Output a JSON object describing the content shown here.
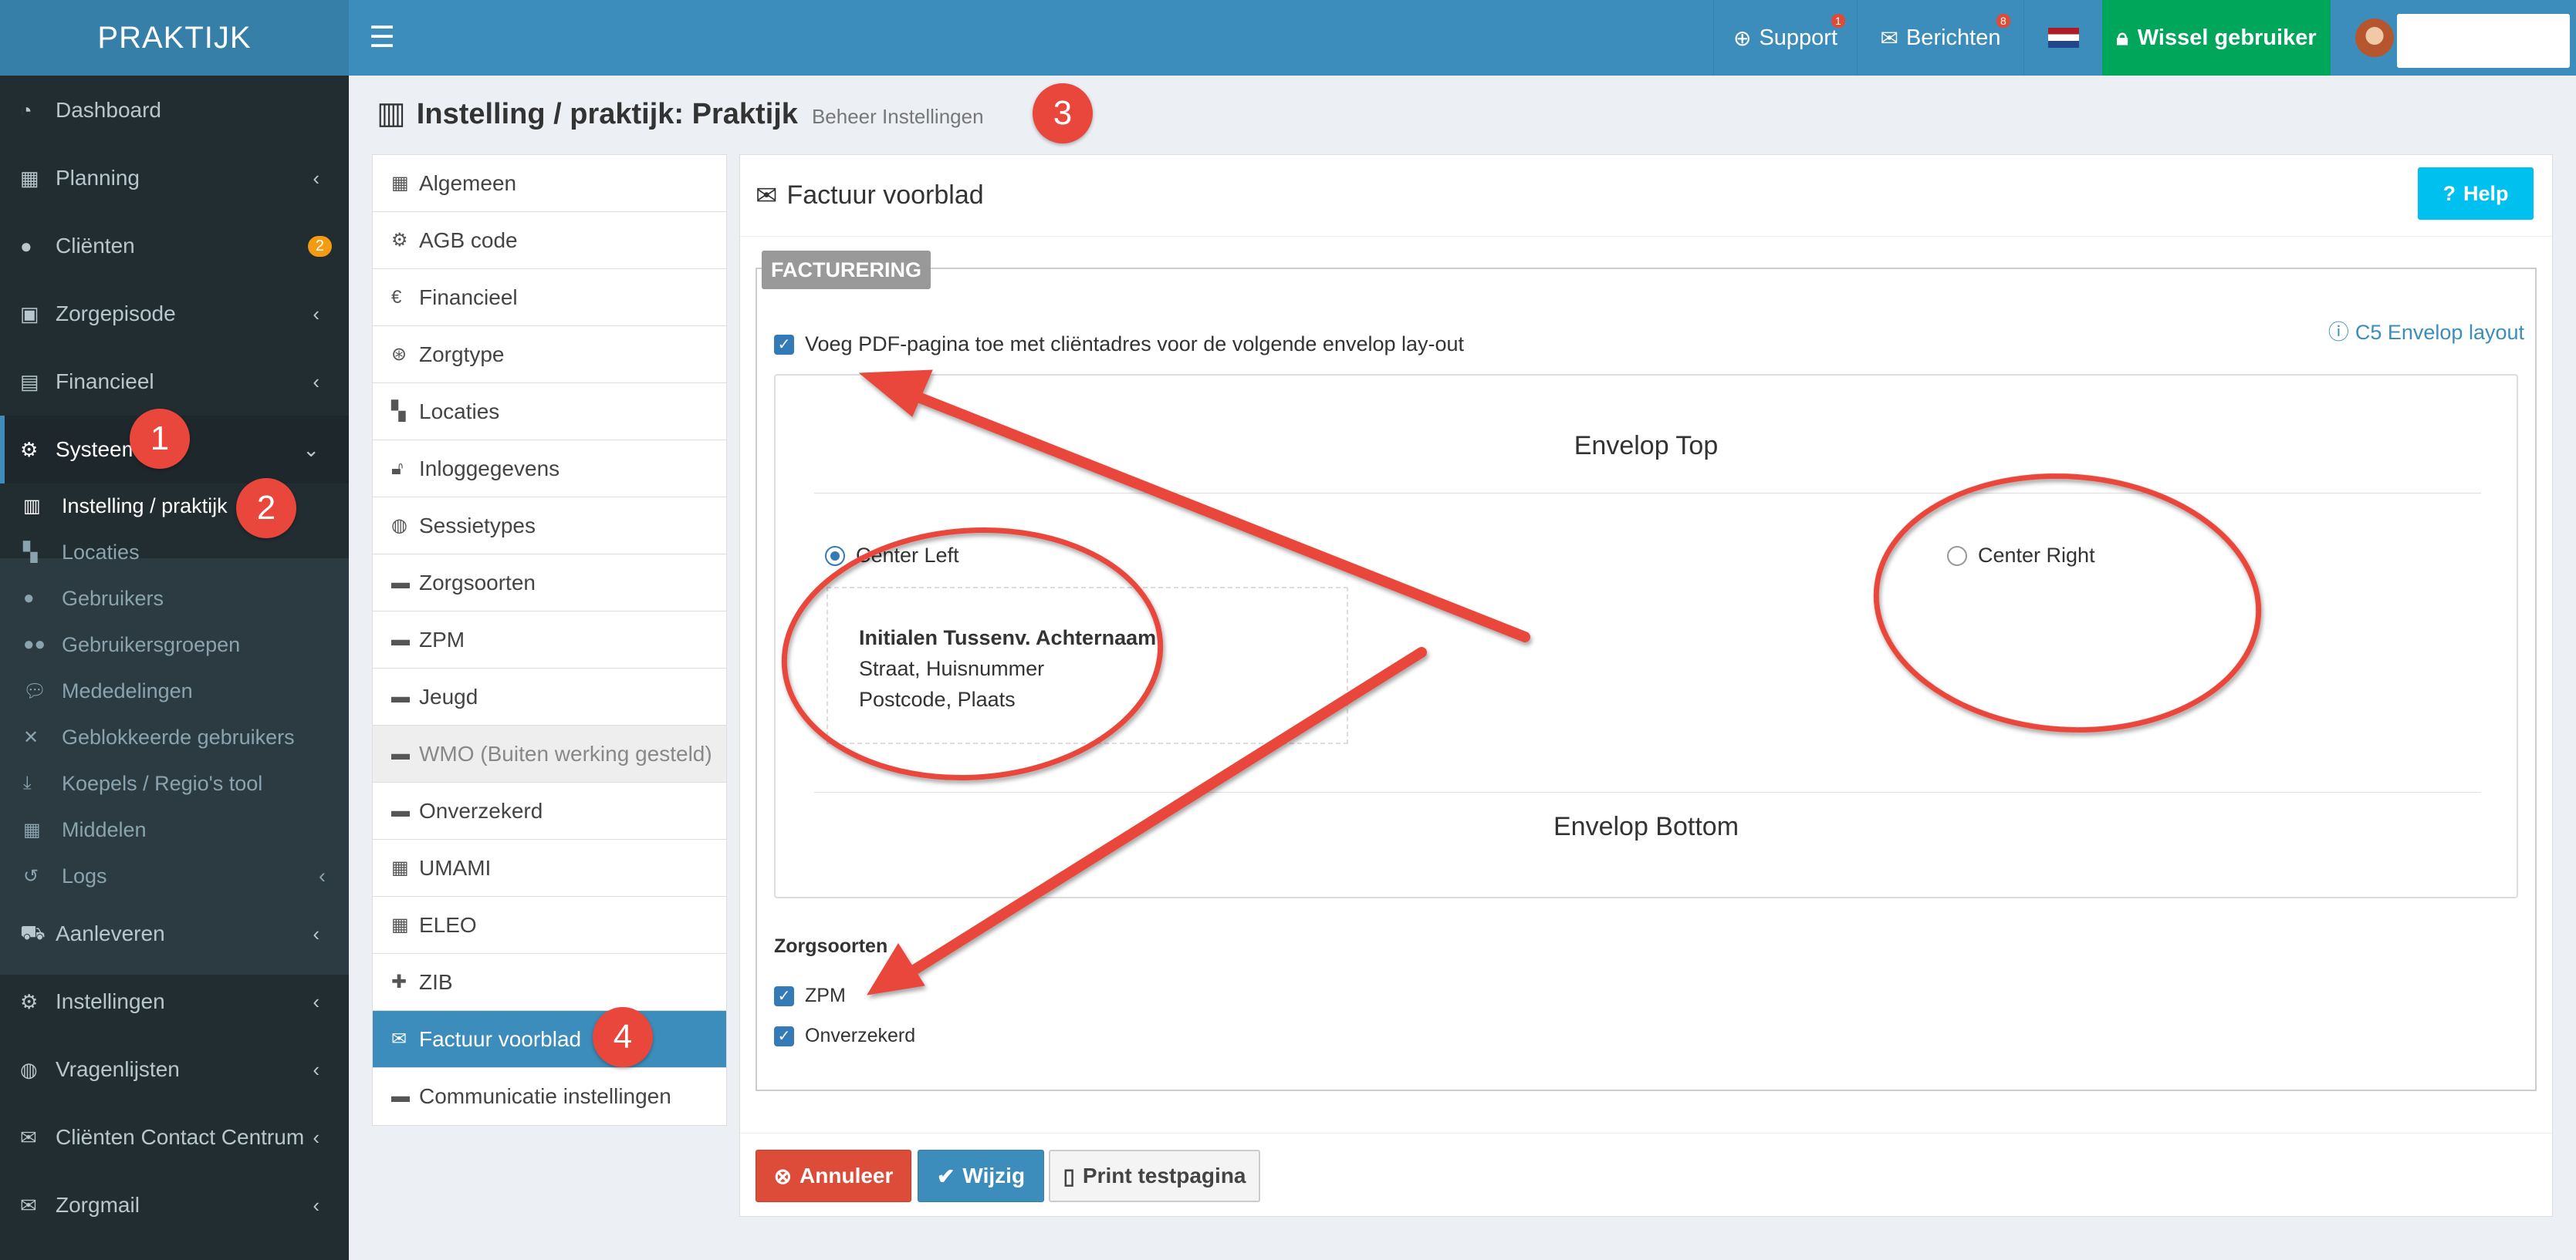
{
  "topbar": {
    "brand": "PRAKTIJK",
    "support_label": "Support",
    "support_badge": "1",
    "messages_label": "Berichten",
    "messages_badge": "8",
    "switch_user_label": "Wissel gebruiker"
  },
  "sidebar": {
    "items": [
      {
        "label": "Dashboard"
      },
      {
        "label": "Planning"
      },
      {
        "label": "Cliënten",
        "badge": "2"
      },
      {
        "label": "Zorgepisode"
      },
      {
        "label": "Financieel"
      },
      {
        "label": "Systeem"
      },
      {
        "label": "Aanleveren"
      },
      {
        "label": "Instellingen"
      },
      {
        "label": "Vragenlijsten"
      },
      {
        "label": "Cliënten Contact Centrum"
      },
      {
        "label": "Zorgmail"
      }
    ],
    "subitems": [
      {
        "label": "Instelling / praktijk"
      },
      {
        "label": "Locaties"
      },
      {
        "label": "Gebruikers"
      },
      {
        "label": "Gebruikersgroepen"
      },
      {
        "label": "Mededelingen"
      },
      {
        "label": "Geblokkeerde gebruikers"
      },
      {
        "label": "Koepels / Regio's tool"
      },
      {
        "label": "Middelen"
      },
      {
        "label": "Logs"
      }
    ]
  },
  "page": {
    "title": "Instelling / praktijk: Praktijk",
    "subtitle": "Beheer Instellingen"
  },
  "settings_menu": [
    {
      "label": "Algemeen"
    },
    {
      "label": "AGB code"
    },
    {
      "label": "Financieel"
    },
    {
      "label": "Zorgtype"
    },
    {
      "label": "Locaties"
    },
    {
      "label": "Inloggegevens"
    },
    {
      "label": "Sessietypes"
    },
    {
      "label": "Zorgsoorten"
    },
    {
      "label": "ZPM"
    },
    {
      "label": "Jeugd"
    },
    {
      "label": "WMO (Buiten werking gesteld)"
    },
    {
      "label": "Onverzekerd"
    },
    {
      "label": "UMAMI"
    },
    {
      "label": "ELEO"
    },
    {
      "label": "ZIB"
    },
    {
      "label": "Factuur voorblad"
    },
    {
      "label": "Communicatie instellingen"
    }
  ],
  "panel": {
    "title": "Factuur voorblad",
    "help_label": "Help",
    "legend": "FACTURERING",
    "add_pdf_label": "Voeg PDF-pagina toe met cliëntadres voor de volgende envelop lay-out",
    "envelope_link": "C5 Envelop layout",
    "envelope_top": "Envelop Top",
    "envelope_bottom": "Envelop Bottom",
    "center_left": "Center Left",
    "center_right": "Center Right",
    "address": {
      "line1": "Initialen Tussenv. Achternaam",
      "line2": "Straat, Huisnummer",
      "line3": "Postcode, Plaats"
    },
    "zorgsoorten_label": "Zorgsoorten",
    "zorgsoorten": [
      "ZPM",
      "Onverzekerd"
    ]
  },
  "buttons": {
    "cancel": "Annuleer",
    "save": "Wijzig",
    "print": "Print testpagina"
  },
  "markers": [
    "1",
    "2",
    "3",
    "4"
  ],
  "colors": {
    "header": "#3c8dbc",
    "sidebar": "#222d32",
    "success": "#00a65a",
    "danger": "#dd4b39",
    "info": "#00c0ef",
    "annotation": "#e9473b"
  }
}
